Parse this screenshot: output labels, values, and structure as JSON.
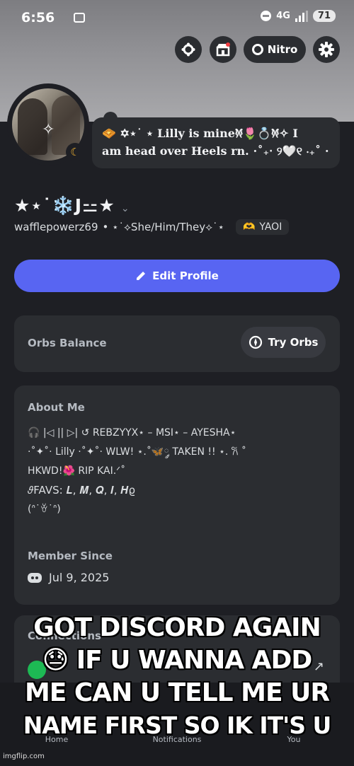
{
  "status_bar": {
    "time": "6:56",
    "network": "4G",
    "battery": "71"
  },
  "header": {
    "nitro_label": "Nitro"
  },
  "profile": {
    "status_line1": "🧇 ✡⋆˙ ⋆ Lilly is mine𐦍💍🌷𐦍✧ I",
    "status_line2": "am head over Heels rn. ⋅˚₊‧ ୨🤍୧ ‧₊˚ ⋅",
    "display_name": "★⋆˙❄️J⚍★",
    "username": "wafflepowerz69",
    "pronouns": "• ⋆˙⟡She/Him/They⟡˙⋆",
    "tag_emoji": "🫶",
    "tag_label": "YAOI",
    "edit_label": "Edit Profile"
  },
  "orbs": {
    "label": "Orbs Balance",
    "button": "Try Orbs"
  },
  "about": {
    "title": "About Me",
    "lines": [
      "🎧 |◁  ||  ▷|  ↺  REBZYYX⋆ – MSI⋆ – AYESHA⋆",
      "⋅˚✦˚⋅ Lilly ⋅˚✦˚⋅ WLW! ⋆.˚🦋༘ TAKEN !! ⋆. 𐙚 ˚",
      "HKWD!🌺  RIP KAI.ᐟ˚",
      "𝜗FAVS: 𝑳, 𝑴, 𝑸, 𝑰, 𝑯ϱ",
      "(ᐢ˙ꈊ˙ᐢ)"
    ],
    "member_title": "Member Since",
    "member_date": "Jul 9, 2025"
  },
  "connections": {
    "title": "Connections"
  },
  "nav": {
    "home": "Home",
    "notifications": "Notifications",
    "you": "You"
  },
  "meme": {
    "line1": "GOT DISCORD AGAIN",
    "line2": "😓 IF U WANNA ADD",
    "line3": "ME CAN U TELL ME UR",
    "line4": "NAME FIRST SO IK IT'S U"
  },
  "credit": "imgflip.com"
}
